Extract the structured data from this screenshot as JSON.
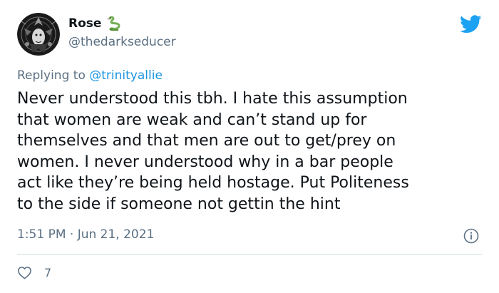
{
  "author": {
    "display_name": "Rose",
    "handle": "@thedarkseducer",
    "name_emoji": "snake-emoji",
    "avatar_icon": "profile-avatar"
  },
  "platform_icon": "twitter-bird-icon",
  "reply": {
    "prefix": "Replying to",
    "mention": "@trinityallie"
  },
  "tweet": {
    "lines": [
      "Never understood this tbh. I hate this assumption",
      "that women are weak and can’t stand up for",
      "themselves and that men are out to get/prey on",
      "women. I never understood why in a bar people",
      "act like they’re being held hostage. Put Politeness",
      "to the side if someone not gettin the hint"
    ]
  },
  "meta": {
    "timestamp": "1:51 PM · Jun 21, 2021"
  },
  "engagement": {
    "like_count": "7"
  },
  "colors": {
    "text": "#0f1419",
    "secondary": "#5b7083",
    "link": "#1b95e0",
    "twitter_blue": "#1da1f2",
    "divider": "#cfd9de",
    "emoji_green": "#78b159"
  }
}
